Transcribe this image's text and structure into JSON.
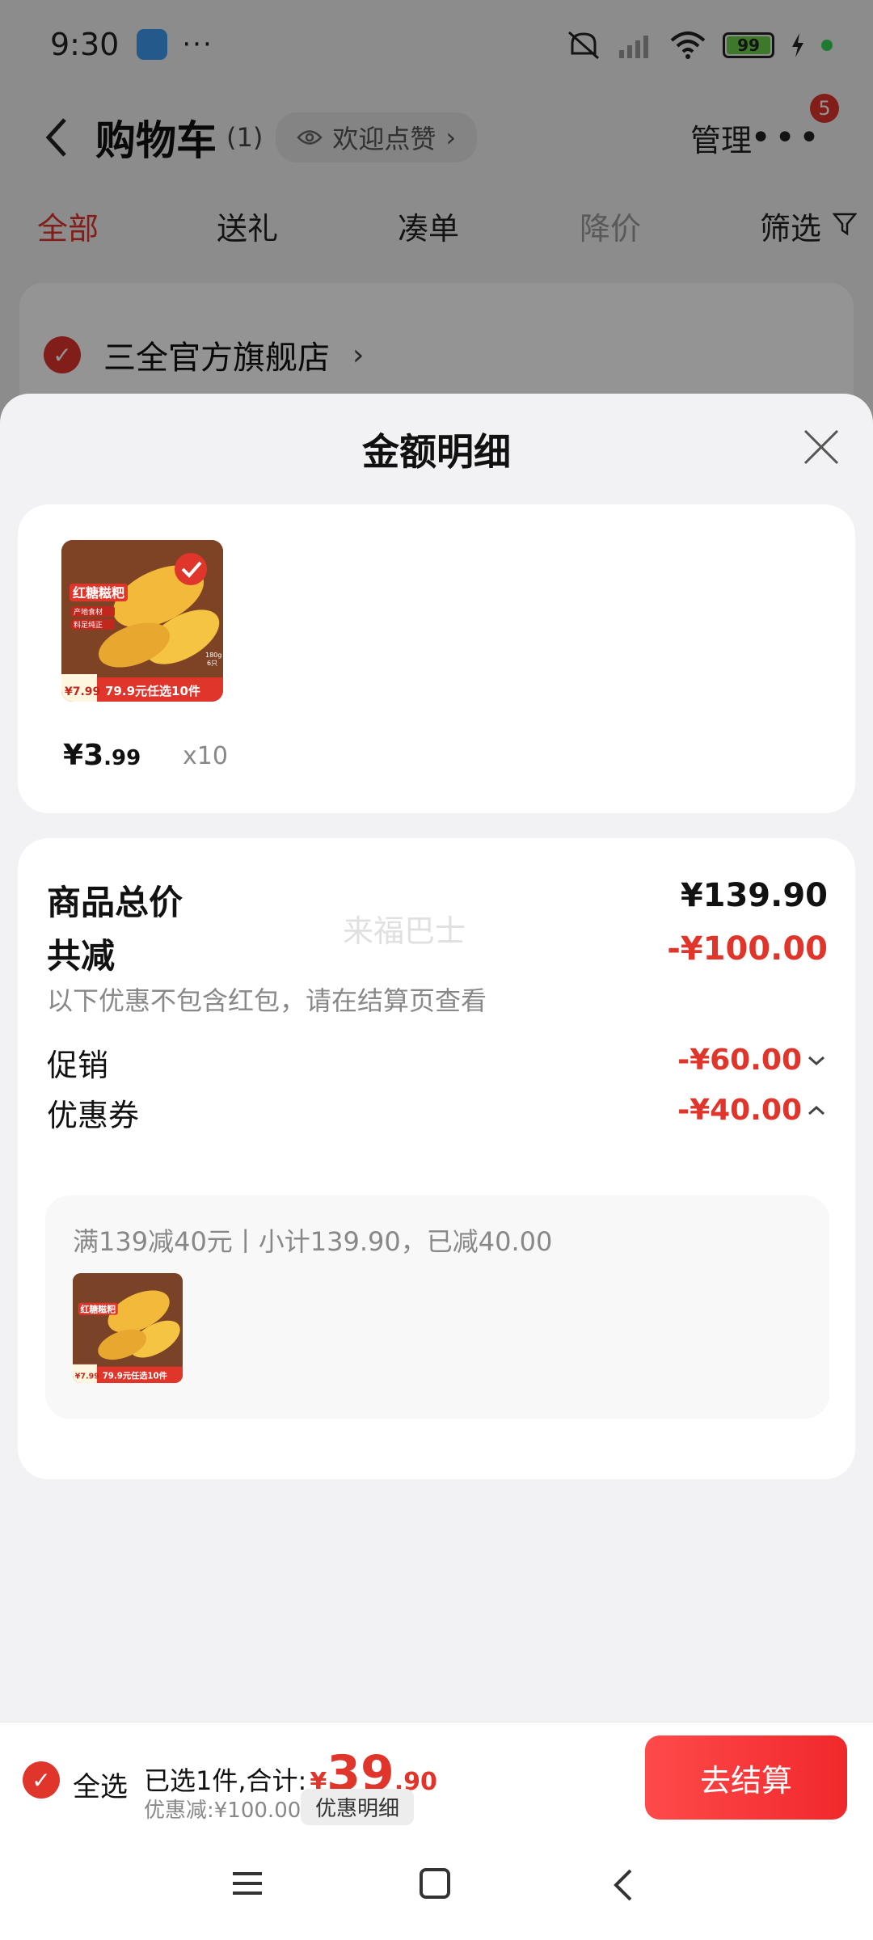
{
  "status_bar": {
    "time": "9:30",
    "more": "···",
    "battery": "99"
  },
  "header": {
    "title": "购物车",
    "count": "(1)",
    "welcome": "欢迎点赞",
    "welcome_arrow": "›",
    "manage": "管理",
    "more": "•••",
    "badge": "5"
  },
  "tabs": [
    {
      "label": "全部",
      "state": "active"
    },
    {
      "label": "送礼",
      "state": "normal"
    },
    {
      "label": "凑单",
      "state": "normal"
    },
    {
      "label": "降价",
      "state": "disabled"
    },
    {
      "label": "筛选",
      "state": "normal"
    }
  ],
  "store": {
    "name": "三全官方旗舰店",
    "arrow": "›"
  },
  "sheet": {
    "title": "金额明细",
    "product": {
      "thumb": {
        "name_text": "红糖糍粑",
        "tags": [
          "产地食材",
          "料足纯正"
        ],
        "price_tag": "¥7.99",
        "promo": "79.9元任选10件",
        "weight": "180g",
        "pieces": "6只"
      },
      "price_symbol": "¥",
      "price_int": "3",
      "price_dec": ".99",
      "quantity": "x10"
    },
    "details": {
      "total_label": "商品总价",
      "total_value": "¥139.90",
      "watermark": "来福巴士",
      "reduce_label": "共减",
      "reduce_value": "-¥100.00",
      "reduce_note": "以下优惠不包含红包，请在结算页查看",
      "promo_label": "促销",
      "promo_value": "-¥60.00",
      "coupon_label": "优惠券",
      "coupon_value": "-¥40.00",
      "coupon_detail": "满139减40元丨小计139.90，已减40.00"
    }
  },
  "bottom_bar": {
    "select_all": "全选",
    "selected_text": "已选1件,合计:",
    "total_symbol": "¥",
    "total_int": "39",
    "total_dec": ".90",
    "discount_text": "优惠减:¥100.00",
    "detail_button": "优惠明细",
    "checkout": "去结算"
  },
  "colors": {
    "accent": "#e0352b",
    "checkout": "#f0282b"
  }
}
